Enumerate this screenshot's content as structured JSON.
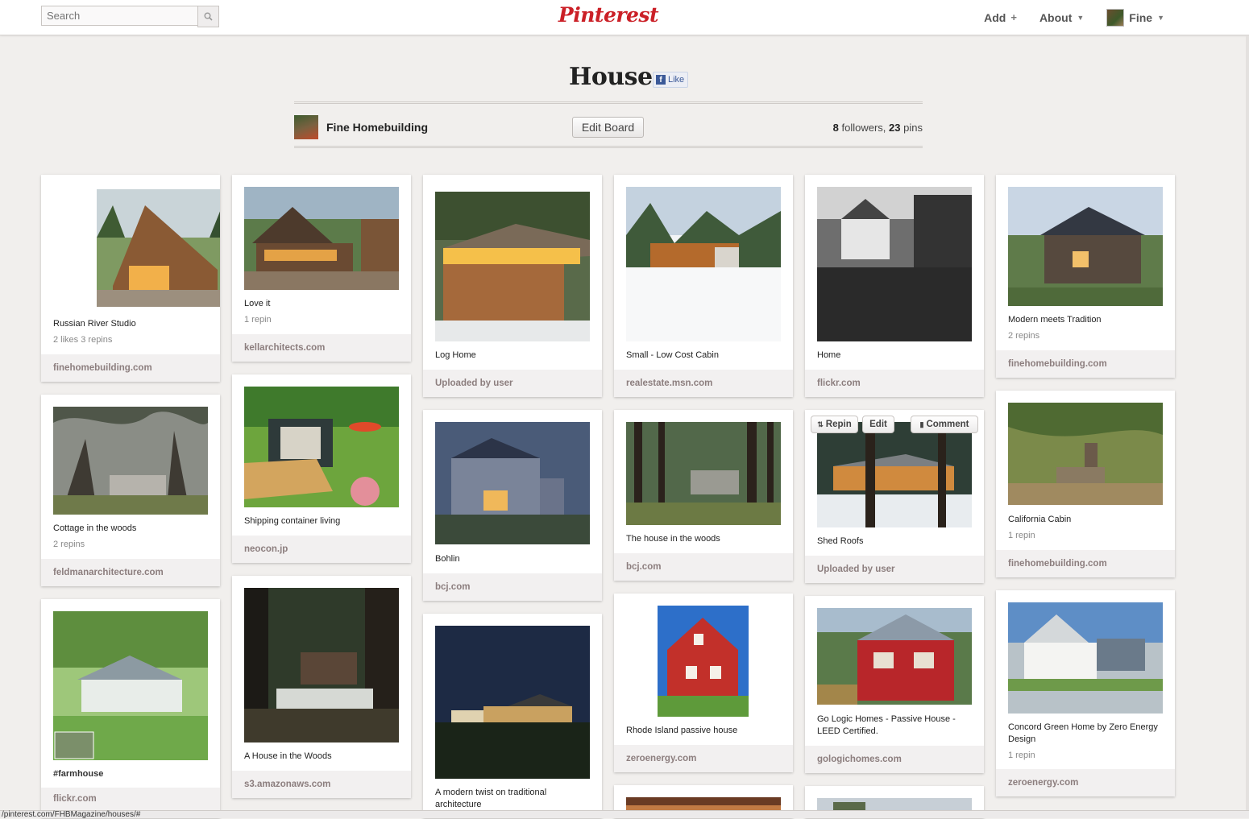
{
  "header": {
    "search_placeholder": "Search",
    "logo": "Pinterest",
    "nav": {
      "add": "Add",
      "about": "About",
      "user": "Fine"
    }
  },
  "board": {
    "title": "Houses",
    "like": "Like",
    "owner": "Fine Homebuilding",
    "edit_label": "Edit Board",
    "followers": "8",
    "followers_label": "followers,",
    "pins": "23",
    "pins_label": "pins"
  },
  "hover_actions": {
    "repin": "Repin",
    "edit": "Edit",
    "comment": "Comment"
  },
  "pins": [
    {
      "desc": "Russian River Studio",
      "meta": "2 likes   3 repins",
      "source": "finehomebuilding.com"
    },
    {
      "desc": "Cottage in the woods",
      "meta": "2 repins",
      "source": "feldmanarchitecture.com"
    },
    {
      "desc": "#farmhouse",
      "meta": "",
      "source": "flickr.com"
    },
    {
      "desc": "Love it",
      "meta": "1 repin",
      "source": "kellarchitects.com"
    },
    {
      "desc": "Shipping container living",
      "meta": "",
      "source": "neocon.jp"
    },
    {
      "desc": "A House in the Woods",
      "meta": "",
      "source": "s3.amazonaws.com"
    },
    {
      "desc": "Log Home",
      "meta": "",
      "source": "Uploaded by user"
    },
    {
      "desc": "Bohlin",
      "meta": "",
      "source": "bcj.com"
    },
    {
      "desc": "A modern twist on traditional architecture",
      "meta": "",
      "source": ""
    },
    {
      "desc": "Small - Low Cost Cabin",
      "meta": "",
      "source": "realestate.msn.com"
    },
    {
      "desc": "The house in the woods",
      "meta": "",
      "source": "bcj.com"
    },
    {
      "desc": "Rhode Island passive house",
      "meta": "",
      "source": "zeroenergy.com"
    },
    {
      "desc": "Home",
      "meta": "",
      "source": "flickr.com"
    },
    {
      "desc": "Shed Roofs",
      "meta": "",
      "source": "Uploaded by user"
    },
    {
      "desc": "Go Logic Homes - Passive House - LEED Certified.",
      "meta": "",
      "source": "gologichomes.com"
    },
    {
      "desc": "Modern meets Tradition",
      "meta": "2 repins",
      "source": "finehomebuilding.com"
    },
    {
      "desc": "California Cabin",
      "meta": "1 repin",
      "source": "finehomebuilding.com"
    },
    {
      "desc": "Concord Green Home by Zero Energy Design",
      "meta": "1 repin",
      "source": "zeroenergy.com"
    }
  ],
  "status_url": "/pinterest.com/FHBMagazine/houses/#"
}
